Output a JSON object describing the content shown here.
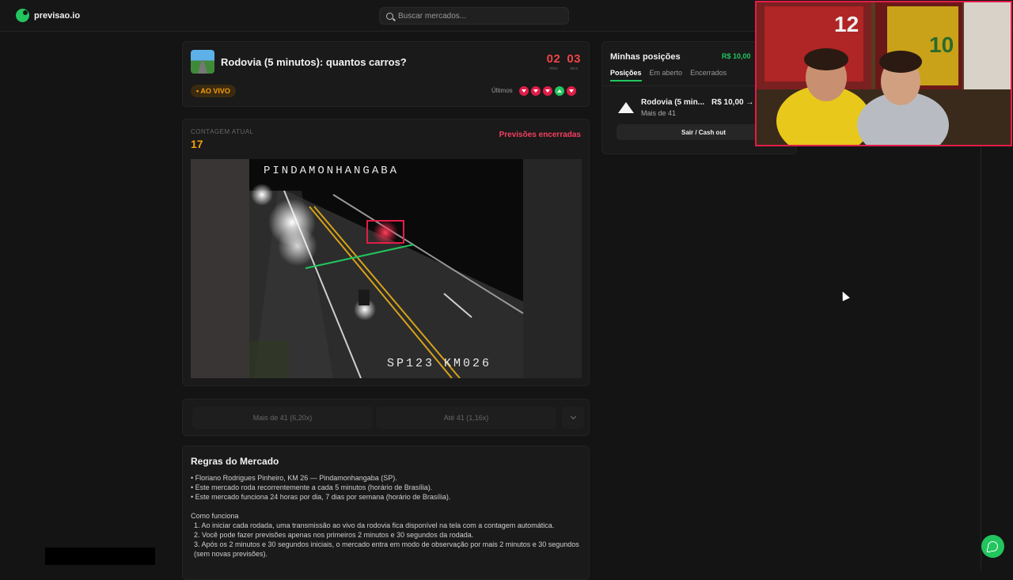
{
  "brand": {
    "name": "previsao.io",
    "accent": "#22c55e"
  },
  "search": {
    "placeholder": "Buscar mercados..."
  },
  "market": {
    "title": "Rodovia (5 minutos): quantos carros?",
    "timer": {
      "minutes": "02",
      "minutes_label": "mins",
      "seconds": "03",
      "seconds_label": "secs"
    },
    "live_badge": "• AO VIVO",
    "last_label": "Últimos",
    "last_results": [
      "down",
      "down",
      "down",
      "up",
      "down"
    ]
  },
  "counter": {
    "label": "CONTAGEM ATUAL",
    "value": "17",
    "status": "Previsões encerradas"
  },
  "video": {
    "location_text": "PINDAMONHANGABA",
    "km_text": "SP123 KM026"
  },
  "bets": {
    "over": "Mais de 41 (6,20x)",
    "under": "Até 41 (1,16x)"
  },
  "rules": {
    "title": "Regras do Mercado",
    "bullets": [
      "• Floriano Rodrigues Pinheiro, KM 26 — Pindamonhangaba (SP).",
      "• Este mercado roda recorrentemente a cada 5 minutos (horário de Brasília).",
      "• Este mercado funciona 24 horas por dia, 7 dias por semana (horário de Brasília)."
    ],
    "how_title": "Como funciona",
    "steps": [
      "1. Ao iniciar cada rodada, uma transmissão ao vivo da rodovia fica disponível na tela com a contagem automática.",
      "2. Você pode fazer previsões apenas nos primeiros 2 minutos e 30 segundos da rodada.",
      "3. Após os 2 minutos e 30 segundos iniciais, o mercado entra em modo de observação por mais 2 minutos e 30 segundos (sem novas previsões)."
    ]
  },
  "positions": {
    "title": "Minhas posições",
    "total": "R$ 10,00",
    "tabs": [
      "Posições",
      "Em aberto",
      "Encerrados"
    ],
    "item": {
      "title": "Rodovia (5 min...",
      "subtitle": "Mais de 41",
      "amount": "R$ 10,00 →"
    },
    "cashout": "Sair / Cash out"
  },
  "webcam": {
    "jersey_left": "12",
    "jersey_right": "10"
  }
}
